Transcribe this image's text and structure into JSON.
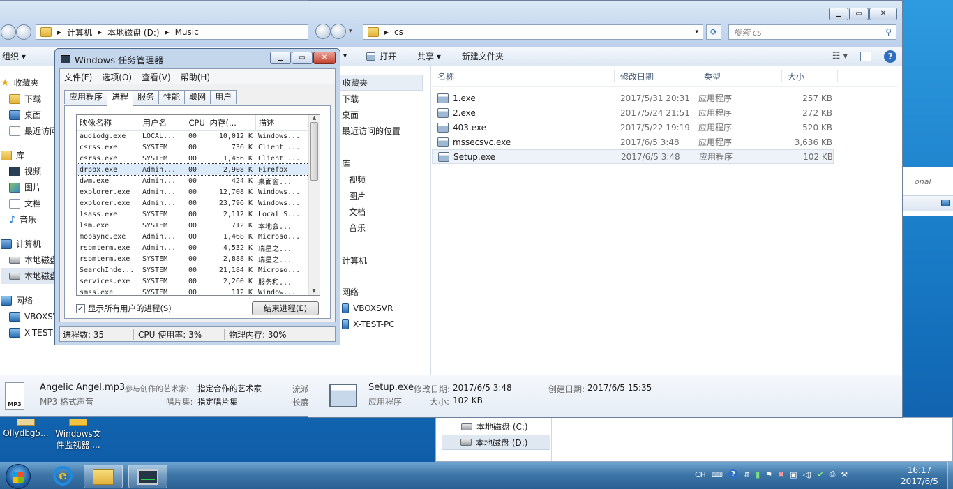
{
  "left_explorer": {
    "breadcrumb": [
      "计算机",
      "本地磁盘 (D:)",
      "Music"
    ],
    "toolbar_organize": "组织",
    "nav": {
      "favorites": "收藏夹",
      "downloads": "下载",
      "desktop": "桌面",
      "recent": "最近访问",
      "libraries": "库",
      "videos": "视频",
      "pictures": "图片",
      "documents": "文档",
      "music": "音乐",
      "computer": "计算机",
      "local_disk_1": "本地磁盘",
      "local_disk_2": "本地磁盘",
      "network": "网络",
      "net_1": "VBOXSVF",
      "net_2": "X-TEST-PC"
    },
    "details": {
      "filename": "Angelic Angel.mp3",
      "type": "MP3 格式声音",
      "contrib_label": "参与创作的艺术家:",
      "contrib_value": "指定合作的艺术家",
      "album_label": "唱片集:",
      "album_value": "指定唱片集",
      "extra1": "流派",
      "extra2": "长度",
      "icon_text": "MP3"
    }
  },
  "task_manager": {
    "title": "Windows 任务管理器",
    "menu": [
      "文件(F)",
      "选项(O)",
      "查看(V)",
      "帮助(H)"
    ],
    "tabs": [
      "应用程序",
      "进程",
      "服务",
      "性能",
      "联网",
      "用户"
    ],
    "active_tab": 1,
    "columns": [
      "映像名称",
      "用户名",
      "CPU",
      "内存(...",
      "描述"
    ],
    "processes": [
      [
        "audiodg.exe",
        "LOCAL...",
        "00",
        "10,012 K",
        "Windows..."
      ],
      [
        "csrss.exe",
        "SYSTEM",
        "00",
        "736 K",
        "Client ..."
      ],
      [
        "csrss.exe",
        "SYSTEM",
        "00",
        "1,456 K",
        "Client ..."
      ],
      [
        "drpbx.exe",
        "Admin...",
        "00",
        "2,908 K",
        "Firefox"
      ],
      [
        "dwm.exe",
        "Admin...",
        "00",
        "424 K",
        "桌面窗..."
      ],
      [
        "explorer.exe",
        "Admin...",
        "00",
        "12,708 K",
        "Windows..."
      ],
      [
        "explorer.exe",
        "Admin...",
        "00",
        "23,796 K",
        "Windows..."
      ],
      [
        "lsass.exe",
        "SYSTEM",
        "00",
        "2,112 K",
        "Local S..."
      ],
      [
        "lsm.exe",
        "SYSTEM",
        "00",
        "712 K",
        "本地会..."
      ],
      [
        "mobsync.exe",
        "Admin...",
        "00",
        "1,468 K",
        "Microso..."
      ],
      [
        "rsbmterm.exe",
        "Admin...",
        "00",
        "4,532 K",
        "瑞星之..."
      ],
      [
        "rsbmterm.exe",
        "SYSTEM",
        "00",
        "2,888 K",
        "瑞星之..."
      ],
      [
        "SearchInde...",
        "SYSTEM",
        "00",
        "21,184 K",
        "Microso..."
      ],
      [
        "services.exe",
        "SYSTEM",
        "00",
        "2,260 K",
        "服务和..."
      ],
      [
        "smss.exe",
        "SYSTEM",
        "00",
        "112 K",
        "Window..."
      ]
    ],
    "selected_row": 3,
    "show_all_label": "显示所有用户的进程(S)",
    "show_all_checked": true,
    "end_process_label": "结束进程(E)",
    "status": {
      "processes": "进程数: 35",
      "cpu": "CPU 使用率: 3%",
      "memory": "物理内存: 30%"
    }
  },
  "right_explorer": {
    "path": "cs",
    "search_placeholder": "搜索 cs",
    "cmd": {
      "open": "打开",
      "share": "共享",
      "new_folder": "新建文件夹"
    },
    "nav": {
      "favorites": "收藏夹",
      "downloads": "下载",
      "desktop": "桌面",
      "recent": "最近访问的位置",
      "libraries": "库",
      "videos": "视频",
      "pictures": "图片",
      "documents": "文档",
      "music": "音乐",
      "computer": "计算机",
      "network": "网络",
      "net_1": "VBOXSVR",
      "net_2": "X-TEST-PC"
    },
    "columns": [
      "名称",
      "修改日期",
      "类型",
      "大小"
    ],
    "files": [
      {
        "name": "1.exe",
        "date": "2017/5/31 20:31",
        "type": "应用程序",
        "size": "257 KB"
      },
      {
        "name": "2.exe",
        "date": "2017/5/24 21:51",
        "type": "应用程序",
        "size": "272 KB"
      },
      {
        "name": "403.exe",
        "date": "2017/5/22 19:19",
        "type": "应用程序",
        "size": "520 KB"
      },
      {
        "name": "mssecsvc.exe",
        "date": "2017/6/5 3:48",
        "type": "应用程序",
        "size": "3,636 KB"
      },
      {
        "name": "Setup.exe",
        "date": "2017/6/5 3:48",
        "type": "应用程序",
        "size": "102 KB"
      }
    ],
    "selected_file": 4,
    "details": {
      "name": "Setup.exe",
      "modified_label": "修改日期:",
      "modified": "2017/6/5 3:48",
      "created_label": "创建日期:",
      "created": "2017/6/5 15:35",
      "type": "应用程序",
      "size_label": "大小:",
      "size": "102 KB"
    }
  },
  "background_window": {
    "disk_c": "本地磁盘 (C:)",
    "disk_d": "本地磁盘 (D:)",
    "partial_text": "onal"
  },
  "desktop_icons": [
    {
      "label": "Ollydbg5..."
    },
    {
      "label": "Windows文件监视器 ..."
    }
  ],
  "taskbar": {
    "tray_lang": "CH",
    "time": "16:17",
    "date": "2017/6/5"
  }
}
